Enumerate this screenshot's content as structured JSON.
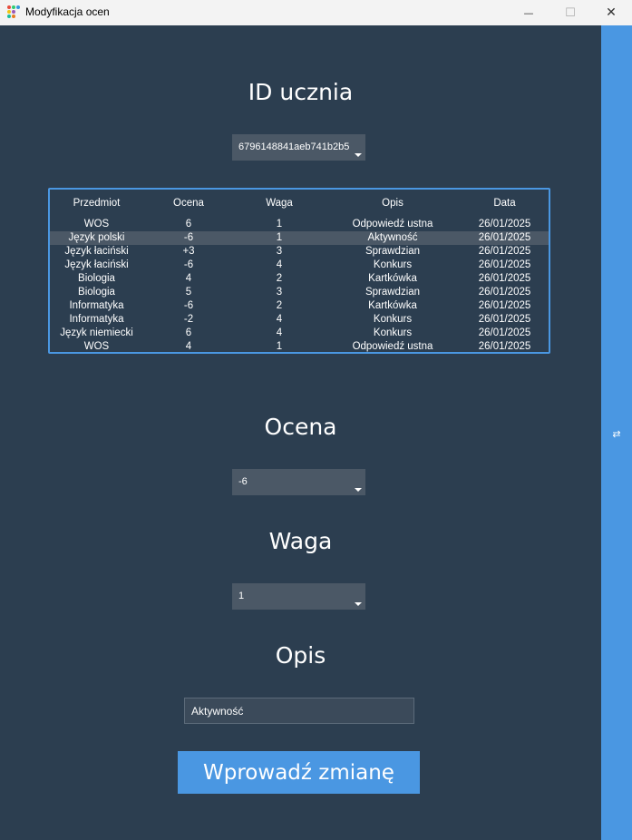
{
  "window": {
    "title": "Modyfikacja ocen",
    "minimize_glyph": "—",
    "maximize_glyph": "☐",
    "close_glyph": "✕"
  },
  "sidebar": {
    "toggle_glyph": "⇄",
    "color": "#4a97e2"
  },
  "student": {
    "heading": "ID ucznia",
    "selected_id": "6796148841aeb741b2b5"
  },
  "grades_table": {
    "columns": [
      "Przedmiot",
      "Ocena",
      "Waga",
      "Opis",
      "Data"
    ],
    "selected_row": 1,
    "rows": [
      [
        "WOS",
        "6",
        "1",
        "Odpowiedź ustna",
        "26/01/2025"
      ],
      [
        "Język polski",
        "-6",
        "1",
        "Aktywność",
        "26/01/2025"
      ],
      [
        "Język łaciński",
        "+3",
        "3",
        "Sprawdzian",
        "26/01/2025"
      ],
      [
        "Język łaciński",
        "-6",
        "4",
        "Konkurs",
        "26/01/2025"
      ],
      [
        "Biologia",
        "4",
        "2",
        "Kartkówka",
        "26/01/2025"
      ],
      [
        "Biologia",
        "5",
        "3",
        "Sprawdzian",
        "26/01/2025"
      ],
      [
        "Informatyka",
        "-6",
        "2",
        "Kartkówka",
        "26/01/2025"
      ],
      [
        "Informatyka",
        "-2",
        "4",
        "Konkurs",
        "26/01/2025"
      ],
      [
        "Język niemiecki",
        "6",
        "4",
        "Konkurs",
        "26/01/2025"
      ],
      [
        "WOS",
        "4",
        "1",
        "Odpowiedź ustna",
        "26/01/2025"
      ]
    ]
  },
  "grade": {
    "heading": "Ocena",
    "selected": "-6"
  },
  "weight": {
    "heading": "Waga",
    "selected": "1"
  },
  "description": {
    "heading": "Opis",
    "value": "Aktywność"
  },
  "submit_label": "Wprowadź zmianę",
  "colors": {
    "background": "#2c3e50",
    "accent": "#4a97e2",
    "control": "#4b5866"
  }
}
